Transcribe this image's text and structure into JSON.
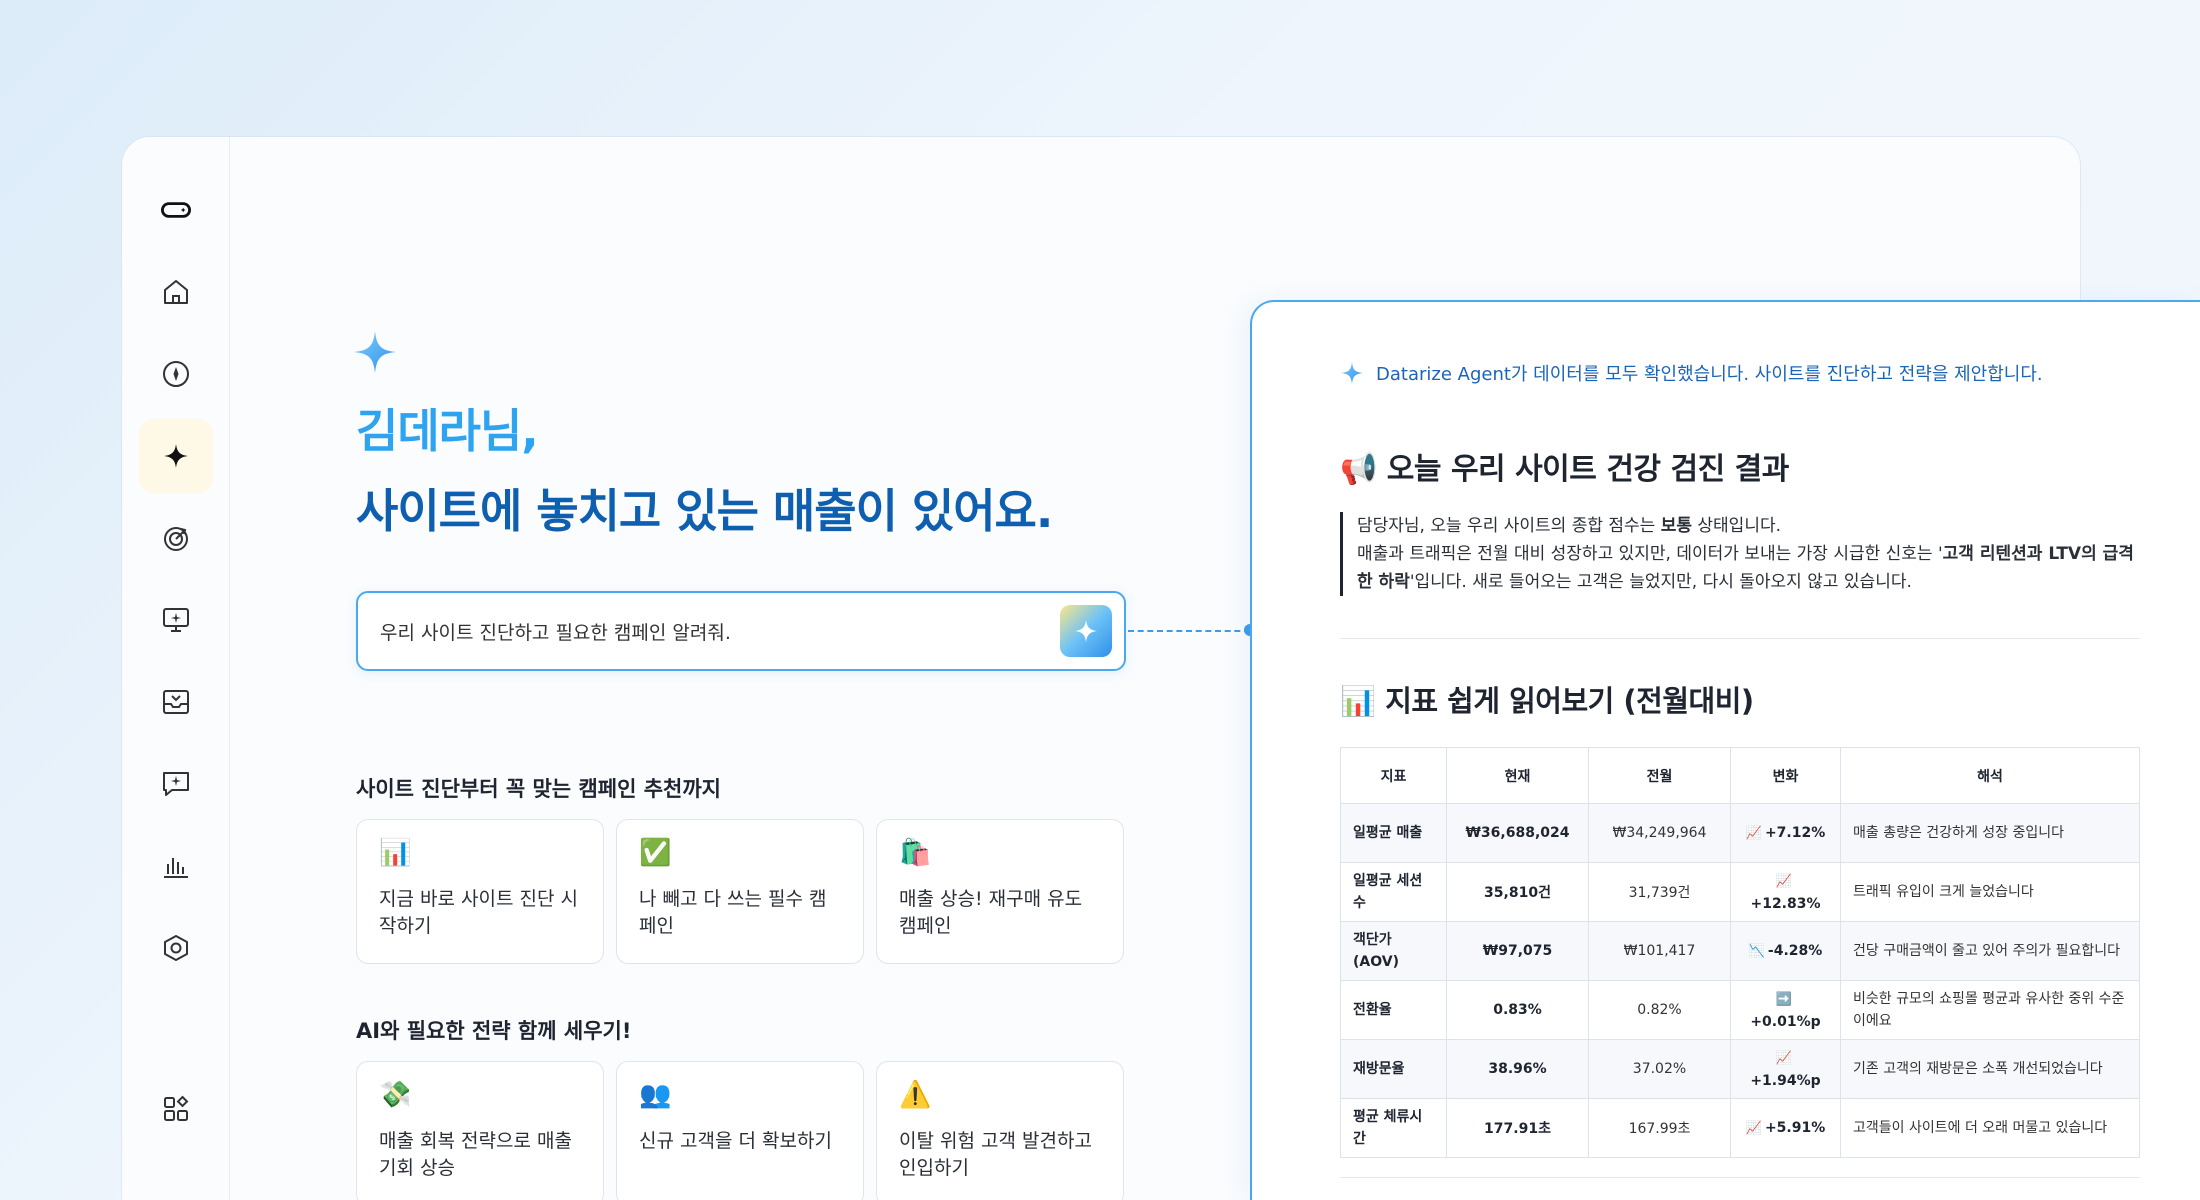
{
  "sidebar": {
    "items": [
      {
        "name": "logo",
        "icon": "pill-logo-icon"
      },
      {
        "name": "home",
        "icon": "home-icon"
      },
      {
        "name": "compass",
        "icon": "compass-icon"
      },
      {
        "name": "ai-agent",
        "icon": "sparkle-icon",
        "active": true
      },
      {
        "name": "target",
        "icon": "target-icon"
      },
      {
        "name": "monitor",
        "icon": "monitor-icon"
      },
      {
        "name": "inbox",
        "icon": "inbox-icon"
      },
      {
        "name": "message",
        "icon": "message-icon"
      },
      {
        "name": "chart",
        "icon": "bar-chart-icon"
      },
      {
        "name": "settings",
        "icon": "hexagon-icon"
      },
      {
        "name": "apps",
        "icon": "apps-icon"
      }
    ]
  },
  "hero": {
    "name": "김데라님,",
    "subtitle": "사이트에 놓치고 있는 매출이 있어요."
  },
  "prompt": {
    "value": "우리 사이트 진단하고 필요한 캠페인 알려줘."
  },
  "section1": {
    "title": "사이트 진단부터 꼭 맞는 캠페인 추천까지",
    "cards": [
      {
        "emoji": "📊",
        "label": "지금 바로 사이트 진단 시작하기"
      },
      {
        "emoji": "✅",
        "label": "나 빼고 다 쓰는 필수 캠페인"
      },
      {
        "emoji": "🛍️",
        "label": "매출 상승! 재구매 유도 캠페인"
      }
    ]
  },
  "section2": {
    "title": "AI와 필요한 전략 함께 세우기!",
    "cards": [
      {
        "emoji": "💸",
        "label": "매출 회복 전략으로 매출 기회 상승"
      },
      {
        "emoji": "👥",
        "label": "신규 고객을 더 확보하기"
      },
      {
        "emoji": "⚠️",
        "label": "이탈 위험 고객 발견하고 인입하기"
      }
    ]
  },
  "panel": {
    "agent_message": "Datarize Agent가 데이터를 모두 확인했습니다. 사이트를 진단하고 전략을 제안합니다.",
    "health_title": "📢 오늘 우리 사이트 건강 검진 결과",
    "quote": {
      "line1_a": "담당자님, 오늘 우리 사이트의 종합 점수는 ",
      "line1_b": "보통",
      "line1_c": " 상태입니다.",
      "line2_a": "매출과 트래픽은 전월 대비 성장하고 있지만, 데이터가 보내는 가장 시급한 신호는 '",
      "line2_b": "고객 리텐션과 LTV의 급격한 하락",
      "line2_c": "'입니다. 새로 들어오는 고객은 늘었지만, 다시 돌아오지 않고 있습니다."
    },
    "metrics_title": "📊 지표 쉽게 읽어보기 (전월대비)",
    "table": {
      "headers": [
        "지표",
        "현재",
        "전월",
        "변화",
        "해석"
      ],
      "rows": [
        {
          "metric": "일평균 매출",
          "current": "₩36,688,024",
          "previous": "₩34,249,964",
          "icon": "📈",
          "change": "+7.12%",
          "note": "매출 총량은 건강하게 성장 중입니다"
        },
        {
          "metric": "일평균 세션 수",
          "current": "35,810건",
          "previous": "31,739건",
          "icon": "📈",
          "change": "+12.83%",
          "note": "트래픽 유입이 크게 늘었습니다"
        },
        {
          "metric": "객단가 (AOV)",
          "current": "₩97,075",
          "previous": "₩101,417",
          "icon": "📉",
          "change": "-4.28%",
          "note": "건당 구매금액이 줄고 있어 주의가 필요합니다"
        },
        {
          "metric": "전환율",
          "current": "0.83%",
          "previous": "0.82%",
          "icon": "➡️",
          "change": "+0.01%p",
          "note": "비슷한 규모의 쇼핑몰 평균과 유사한 중위 수준이에요"
        },
        {
          "metric": "재방문율",
          "current": "38.96%",
          "previous": "37.02%",
          "icon": "📈",
          "change": "+1.94%p",
          "note": "기존 고객의 재방문은 소폭 개선되었습니다"
        },
        {
          "metric": "평균 체류시간",
          "current": "177.91초",
          "previous": "167.99초",
          "icon": "📈",
          "change": "+5.91%",
          "note": "고객들이 사이트에 더 오래 머물고 있습니다"
        }
      ]
    }
  },
  "colors": {
    "accent": "#2ea3f0",
    "accent_dark": "#0e5fb0",
    "border": "#4aa9ee"
  }
}
